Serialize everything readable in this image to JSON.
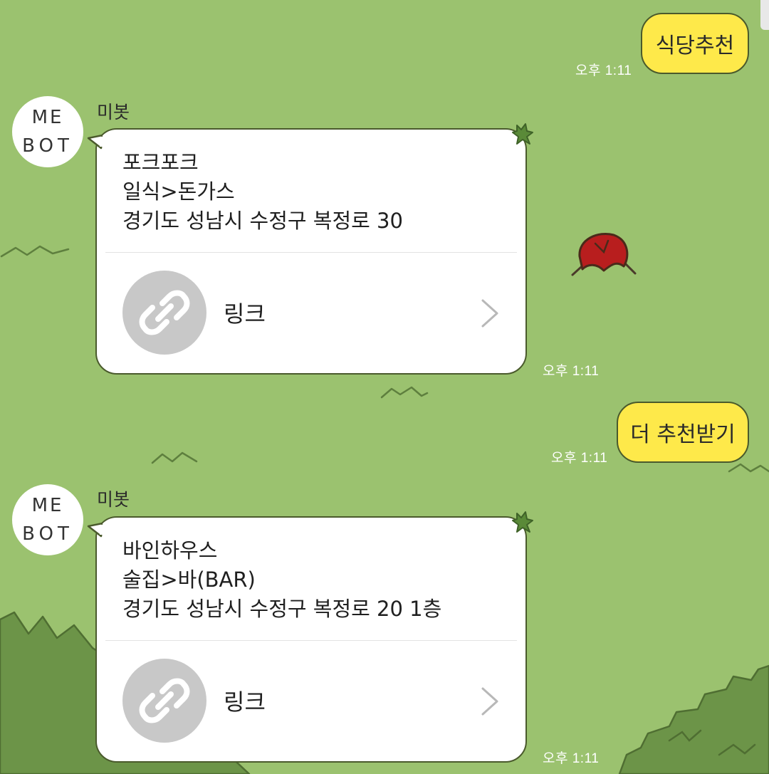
{
  "chat": {
    "messages": [
      {
        "type": "sent",
        "text": "식당추천",
        "time": "오후 1:11"
      },
      {
        "type": "received",
        "sender": "미봇",
        "avatar_text": [
          "ME",
          "BOT"
        ],
        "lines": [
          "포크포크",
          "일식>돈가스",
          "경기도 성남시 수정구 복정로 30"
        ],
        "link_label": "링크",
        "link_icon": "link-icon",
        "time": "오후 1:11"
      },
      {
        "type": "sent",
        "text": "더 추천받기",
        "time": "오후 1:11"
      },
      {
        "type": "received",
        "sender": "미봇",
        "avatar_text": [
          "ME",
          "BOT"
        ],
        "lines": [
          "바인하우스",
          "술집>바(BAR)",
          "경기도 성남시 수정구 복정로 20 1층"
        ],
        "link_label": "링크",
        "link_icon": "link-icon",
        "time": "오후 1:11"
      }
    ]
  },
  "colors": {
    "background": "#9bc26f",
    "sent_bubble": "#fee94a",
    "outline": "#4a5a2c",
    "link_thumb": "#c8c8c8"
  }
}
